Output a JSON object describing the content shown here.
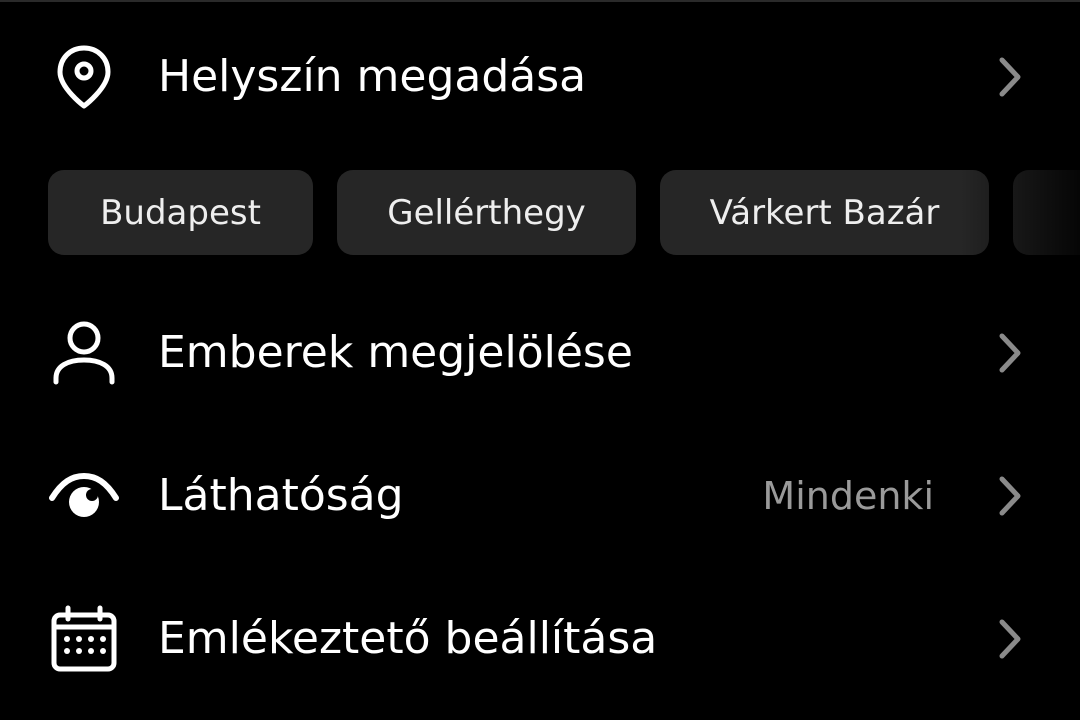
{
  "rows": {
    "location": {
      "label": "Helyszín megadása",
      "icon": "location-pin-icon"
    },
    "people": {
      "label": "Emberek megjelölése",
      "icon": "person-icon"
    },
    "visibility": {
      "label": "Láthatóság",
      "value": "Mindenki",
      "icon": "eye-icon"
    },
    "reminder": {
      "label": "Emlékeztető beállítása",
      "icon": "calendar-icon"
    }
  },
  "location_suggestions": [
    "Budapest",
    "Gellérthegy",
    "Várkert Bazár",
    ""
  ],
  "colors": {
    "background": "#000000",
    "chip_background": "#262626",
    "primary_text": "#ffffff",
    "secondary_text": "#9a9a9a",
    "chevron": "#8a8a8a"
  }
}
